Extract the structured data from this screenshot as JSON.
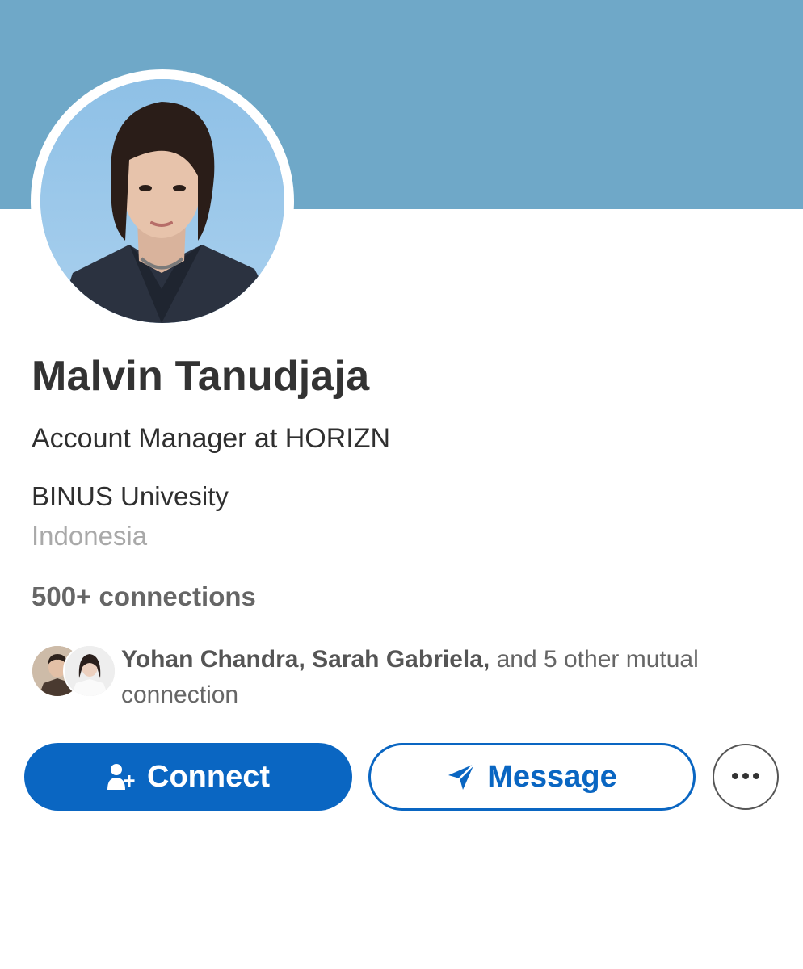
{
  "profile": {
    "name": "Malvin Tanudjaja",
    "headline": "Account Manager at HORIZN",
    "school": "BINUS Univesity",
    "location": "Indonesia",
    "connections": "500+ connections"
  },
  "mutual": {
    "names": "Yohan Chandra, Sarah Gabriela,",
    "rest": " and 5 other mutual connection"
  },
  "actions": {
    "connect_label": "Connect",
    "connect_icon": "add-person-icon",
    "message_label": "Message",
    "message_icon": "send-icon",
    "more_icon": "more-dots-icon"
  },
  "colors": {
    "banner": "#6fa8c8",
    "accent": "#0a66c2"
  }
}
